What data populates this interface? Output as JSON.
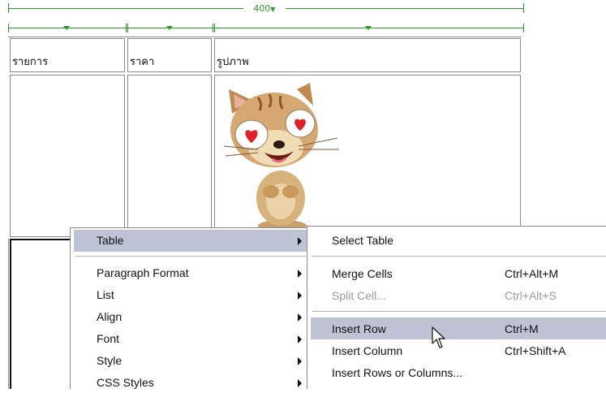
{
  "ruler": {
    "width_label": "400"
  },
  "table": {
    "headers": [
      "รายการ",
      "ราคา",
      "รูปภาพ"
    ]
  },
  "context_menu": {
    "items": [
      {
        "label": "Table"
      },
      {
        "label": "Paragraph Format"
      },
      {
        "label": "List"
      },
      {
        "label": "Align"
      },
      {
        "label": "Font"
      },
      {
        "label": "Style"
      },
      {
        "label": "CSS Styles"
      }
    ]
  },
  "submenu": {
    "items": [
      {
        "label": "Select Table",
        "shortcut": ""
      },
      {
        "label": "Merge Cells",
        "shortcut": "Ctrl+Alt+M"
      },
      {
        "label": "Split Cell...",
        "shortcut": "Ctrl+Alt+S"
      },
      {
        "label": "Insert Row",
        "shortcut": "Ctrl+M"
      },
      {
        "label": "Insert Column",
        "shortcut": "Ctrl+Shift+A"
      },
      {
        "label": "Insert Rows or Columns...",
        "shortcut": ""
      }
    ]
  }
}
